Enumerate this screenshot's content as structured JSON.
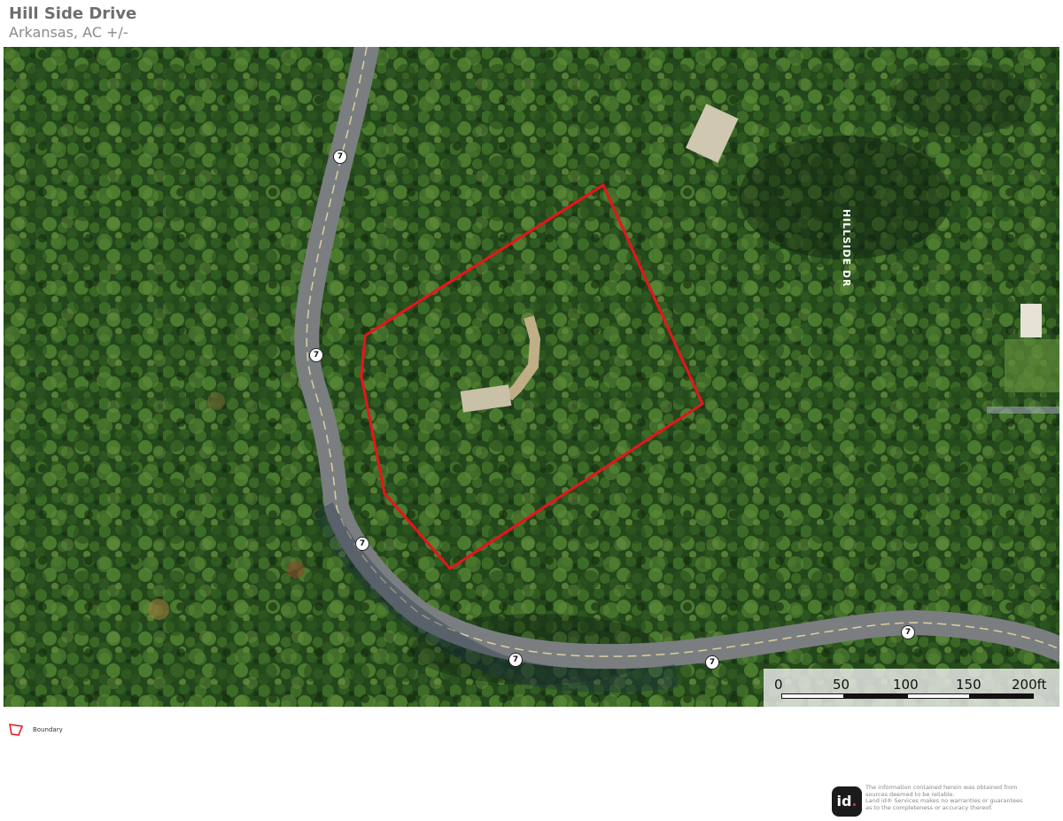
{
  "header": {
    "title": "Hill Side Drive",
    "subtitle": "Arkansas,  AC +/-"
  },
  "map": {
    "road_label": "HILLSIDE DR",
    "route_shield": "7",
    "boundary_color": "#e8141c",
    "scale": {
      "ticks": [
        "0",
        "50",
        "100",
        "150",
        "200ft"
      ]
    }
  },
  "legend": {
    "label": "Boundary",
    "icon": "boundary-polygon-icon"
  },
  "footer": {
    "logo_text": "id",
    "logo_dot": ".",
    "disclaimer_lines": [
      "The information contained herein was obtained from",
      "sources deemed to be reliable.",
      " Land id® Services makes no warranties or guarantees",
      "as to the completeness or accuracy thereof."
    ]
  }
}
